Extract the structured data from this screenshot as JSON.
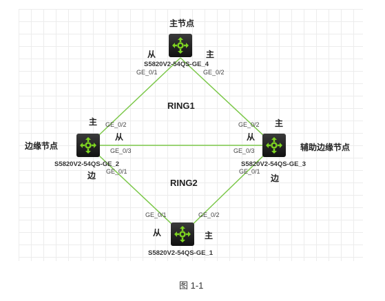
{
  "nodes": {
    "top": {
      "role": "主节点",
      "name": "S5820V2-54QS-GE_4",
      "port_left": "GE_0/1",
      "port_right": "GE_0/2",
      "left_tag": "从",
      "right_tag": "主"
    },
    "left": {
      "role": "边缘节点",
      "name": "S5820V2-54QS-GE_2",
      "port_up": "GE_0/2",
      "port_mid": "GE_0/3",
      "port_down": "GE_0/1",
      "up_tag": "主",
      "mid_tag": "从",
      "down_tag": "边"
    },
    "right": {
      "role": "辅助边缘节点",
      "name": "S5820V2-54QS-GE_3",
      "port_up": "GE_0/2",
      "port_mid": "GE_0/3",
      "port_down": "GE_0/1",
      "up_tag": "主",
      "mid_tag": "从",
      "down_tag": "边"
    },
    "bottom": {
      "name": "S5820V2-54QS-GE_1",
      "port_left": "GE_0/1",
      "port_right": "GE_0/2",
      "left_tag": "从",
      "right_tag": "主"
    }
  },
  "rings": [
    "RING1",
    "RING2"
  ],
  "caption": "图 1-1",
  "colors": {
    "link": "#7cc84a",
    "icon": "#7ed321"
  }
}
